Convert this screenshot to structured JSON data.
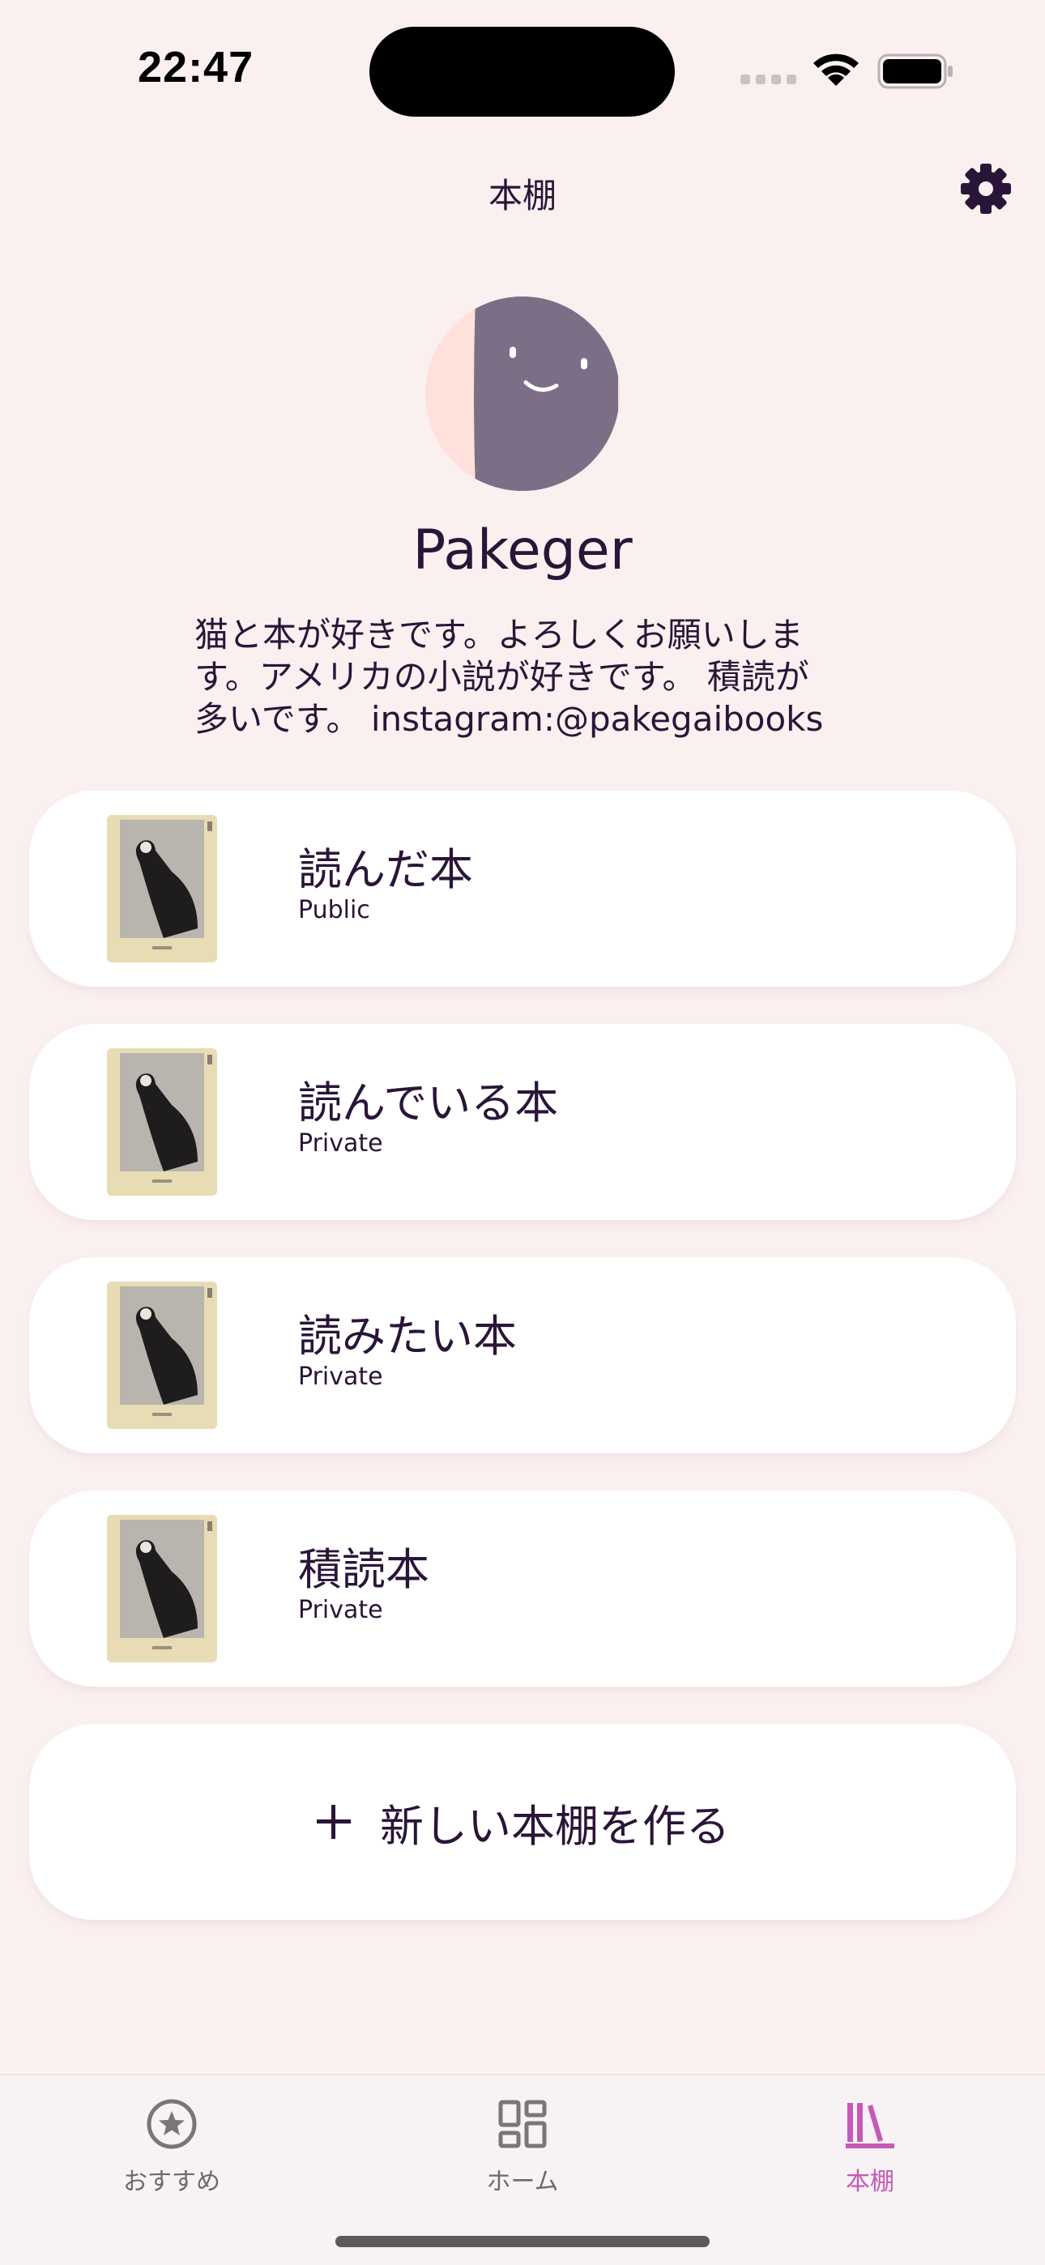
{
  "status_bar": {
    "time": "22:47"
  },
  "header": {
    "title": "本棚"
  },
  "profile": {
    "name": "Pakeger",
    "bio_lines": [
      "猫と本が好きです。よろしくお願いしま",
      "す。アメリカの小説が好きです。 積読が",
      "多いです。 instagram:@pakegaibooks"
    ]
  },
  "shelves": [
    {
      "title": "読んだ本",
      "visibility": "Public"
    },
    {
      "title": "読んでいる本",
      "visibility": "Private"
    },
    {
      "title": "読みたい本",
      "visibility": "Private"
    },
    {
      "title": "積読本",
      "visibility": "Private"
    }
  ],
  "new_shelf": {
    "label": "新しい本棚を作る"
  },
  "tabs": [
    {
      "label": "おすすめ",
      "icon": "star-circle-icon",
      "active": false
    },
    {
      "label": "ホーム",
      "icon": "grid-icon",
      "active": false
    },
    {
      "label": "本棚",
      "icon": "bookshelf-icon",
      "active": true
    }
  ],
  "colors": {
    "background": "#fbf0f0",
    "text": "#2a1538",
    "active_tab": "#c45ab8",
    "inactive_tab": "#6e6a6c"
  }
}
